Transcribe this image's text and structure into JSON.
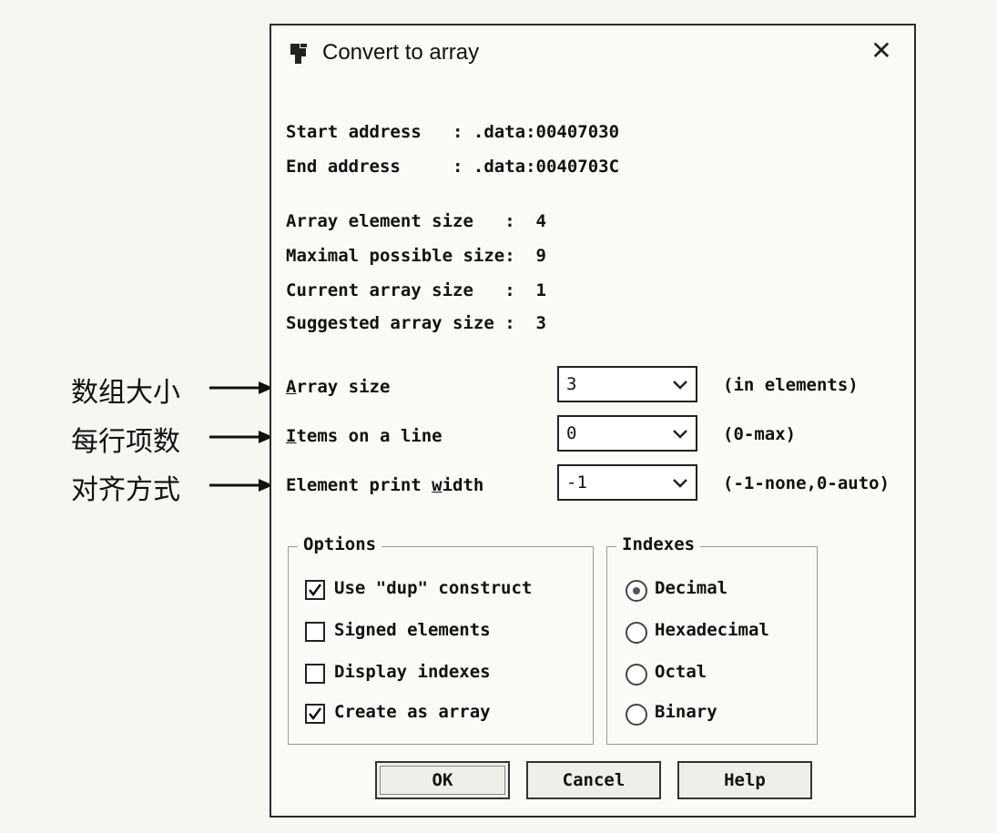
{
  "dialog": {
    "title": "Convert to array",
    "close_icon": "close-icon",
    "app_icon": "ida-app-icon"
  },
  "info": {
    "start_address": "Start address   : .data:00407030",
    "end_address": "End address     : .data:0040703C",
    "array_element_size": "Array element size   :  4",
    "maximal_possible_size": "Maximal possible size:  9",
    "current_array_size": "Current array size   :  1",
    "suggested_array_size": "Suggested array size :  3"
  },
  "fields": {
    "array_size": {
      "label_first": "A",
      "label_rest": "rray size",
      "value": "3",
      "hint": "(in elements)"
    },
    "items_on_line": {
      "label_first": "I",
      "label_rest": "tems on a line",
      "value": "0",
      "hint": "(0-max)"
    },
    "element_print_width": {
      "label_before": "Element print ",
      "label_underline": "w",
      "label_after": "idth",
      "value": "-1",
      "hint": "(-1-none,0-auto)"
    }
  },
  "options": {
    "title": "Options",
    "items": [
      {
        "label": "Use \"dup\" construct",
        "checked": true
      },
      {
        "label": "Signed elements",
        "checked": false
      },
      {
        "label": "Display indexes",
        "checked": false
      },
      {
        "label": "Create as array",
        "checked": true
      }
    ]
  },
  "indexes": {
    "title": "Indexes",
    "items": [
      {
        "label": "Decimal",
        "selected": true
      },
      {
        "label": "Hexadecimal",
        "selected": false
      },
      {
        "label": "Octal",
        "selected": false
      },
      {
        "label": "Binary",
        "selected": false
      }
    ]
  },
  "buttons": {
    "ok": "OK",
    "cancel": "Cancel",
    "help": "Help"
  },
  "annotations": [
    "数组大小",
    "每行项数",
    "对齐方式"
  ],
  "colors": {
    "border": "#2b2b2b",
    "background": "#fbfaf7",
    "button_face": "#efeeea"
  }
}
